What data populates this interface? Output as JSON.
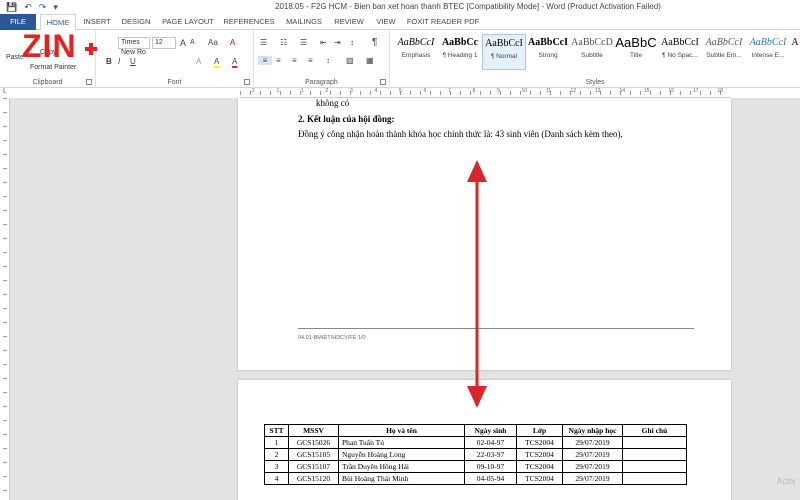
{
  "window": {
    "title": "2018.05 - F2G HCM - Bien ban xet hoan thanh BTEC [Compatibility Mode] - Word (Product Activation Failed)"
  },
  "quick_access": {
    "save_icon": "💾",
    "undo_icon": "↶",
    "redo_icon": "↷",
    "customize_icon": "▾"
  },
  "tabs": [
    {
      "label": "FILE"
    },
    {
      "label": "HOME"
    },
    {
      "label": "INSERT"
    },
    {
      "label": "DESIGN"
    },
    {
      "label": "PAGE LAYOUT"
    },
    {
      "label": "REFERENCES"
    },
    {
      "label": "MAILINGS"
    },
    {
      "label": "REVIEW"
    },
    {
      "label": "VIEW"
    },
    {
      "label": "FOXIT READER PDF"
    }
  ],
  "logo": {
    "text": "ZIN"
  },
  "ribbon": {
    "clipboard": {
      "label": "Clipboard",
      "paste": "Paste",
      "copy": "Copy",
      "format_painter": "Format Painter"
    },
    "font": {
      "label": "Font",
      "font_name": "Times New Ro",
      "font_size": "12",
      "bold": "B",
      "italic": "I",
      "underline": "U",
      "grow": "A",
      "shrink": "A",
      "case": "Aa",
      "clear": "A",
      "highlight": "A",
      "color": "A"
    },
    "paragraph": {
      "label": "Paragraph",
      "pilcrow": "¶"
    },
    "styles": {
      "label": "Styles",
      "items": [
        {
          "preview": "AaBbCcI",
          "name": "Emphasis"
        },
        {
          "preview": "AaBbCc",
          "name": "¶ Heading 1"
        },
        {
          "preview": "AaBbCcI",
          "name": "¶ Normal"
        },
        {
          "preview": "AaBbCcI",
          "name": "Strong"
        },
        {
          "preview": "AaBbCcD",
          "name": "Subtitle"
        },
        {
          "preview": "AaBbC",
          "name": "Title"
        },
        {
          "preview": "AaBbCcI",
          "name": "¶ No Spac..."
        },
        {
          "preview": "AaBbCcI",
          "name": "Subtle Em..."
        },
        {
          "preview": "AaBbCcI",
          "name": "Intense E..."
        },
        {
          "preview": "A",
          "name": ""
        }
      ]
    }
  },
  "ruler": {
    "numbers": [
      "2",
      "1",
      "1",
      "2",
      "3",
      "4",
      "5",
      "6",
      "7",
      "8",
      "9",
      "10",
      "11",
      "12",
      "13",
      "14",
      "15",
      "16",
      "17",
      "18"
    ]
  },
  "document": {
    "page1": {
      "line1": "không có",
      "heading": "2. Kết luận của hội đồng:",
      "body": "Đồng ý công nhận hoàn thành khóa học chính thức là:  43 sinh viên (Danh sách kèm theo),",
      "footer": "04.01-BM/ĐT/HDCV/FE 1/0"
    },
    "table": {
      "headers": [
        "STT",
        "MSSV",
        "Họ và tên",
        "Ngày sinh",
        "Lớp",
        "Ngày nhập học",
        "Ghi chú"
      ],
      "rows": [
        [
          "1",
          "GCS15026",
          "Phan Tuấn Tú",
          "02-04-97",
          "TCS2004",
          "29/07/2019",
          ""
        ],
        [
          "2",
          "GCS15105",
          "Nguyễn Hoàng Long",
          "22-03-97",
          "TCS2004",
          "29/07/2019",
          ""
        ],
        [
          "3",
          "GCS15107",
          "Trần Duyên Hồng Hải",
          "09-10-97",
          "TCS2004",
          "29/07/2019",
          ""
        ],
        [
          "4",
          "GCS15120",
          "Bùi Hoàng Thái Minh",
          "04-05-94",
          "TCS2004",
          "29/07/2019",
          ""
        ]
      ]
    }
  },
  "watermark": "Activ",
  "colors": {
    "accent": "#2b579a",
    "logo": "#e32222",
    "arrow": "#d9262b"
  }
}
